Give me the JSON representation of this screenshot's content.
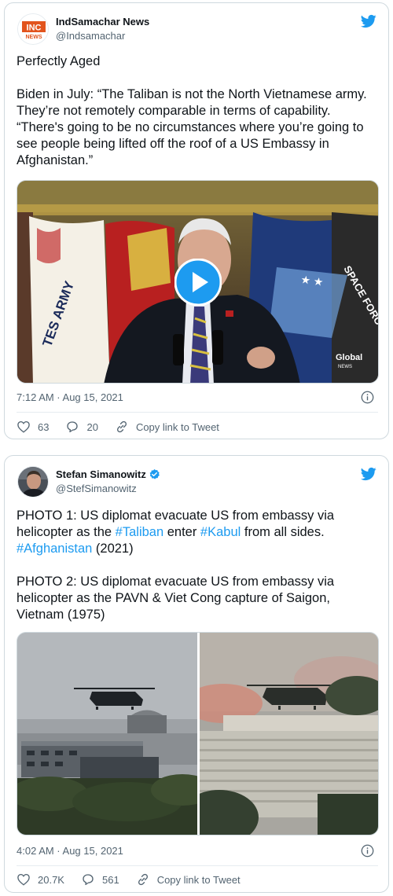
{
  "tweets": [
    {
      "author": {
        "name": "IndSamachar News",
        "handle": "@Indsamachar",
        "avatar_text_top": "INC",
        "avatar_text_bottom": "NEWS",
        "verified": false
      },
      "text": "Perfectly Aged\n\nBiden in July: “The Taliban is not the North Vietnamese army. They’re not remotely comparable in terms of capability. “There's going to be no circumstances where you’re going to see people being lifted off the roof of a US Embassy in Afghanistan.”",
      "media": {
        "type": "video",
        "watermark_top": "Global",
        "watermark_bottom": "NEWS",
        "flag_text_1": "TES ARMY",
        "flag_text_2": "SPACE FORC"
      },
      "timestamp": "7:12 AM · Aug 15, 2021",
      "likes": "63",
      "replies": "20",
      "copy_link": "Copy link to Tweet"
    },
    {
      "author": {
        "name": "Stefan Simanowitz",
        "handle": "@StefSimanowitz",
        "verified": true
      },
      "text": {
        "p1_a": "PHOTO 1: US diplomat evacuate US from embassy via helicopter as the ",
        "tag_taliban": "#Taliban",
        "p1_b": " enter ",
        "tag_kabul": "#Kabul",
        "p1_c": " from all sides. ",
        "tag_afghanistan": "#Afghanistan",
        "p1_d": " (2021)",
        "p2": "PHOTO 2: US diplomat evacuate US from embassy via helicopter as the PAVN & Viet Cong capture of Saigon, Vietnam (1975)"
      },
      "media": {
        "type": "photos",
        "count": 2
      },
      "timestamp": "4:02 AM · Aug 15, 2021",
      "likes": "20.7K",
      "replies": "561",
      "copy_link": "Copy link to Tweet"
    }
  ],
  "colors": {
    "accent": "#1d9bf0",
    "text": "#0f1419",
    "muted": "#536471",
    "border": "#cfd9de"
  },
  "icons": [
    "twitter-bird-icon",
    "info-icon",
    "heart-icon",
    "reply-icon",
    "link-icon",
    "play-icon",
    "verified-badge-icon"
  ]
}
